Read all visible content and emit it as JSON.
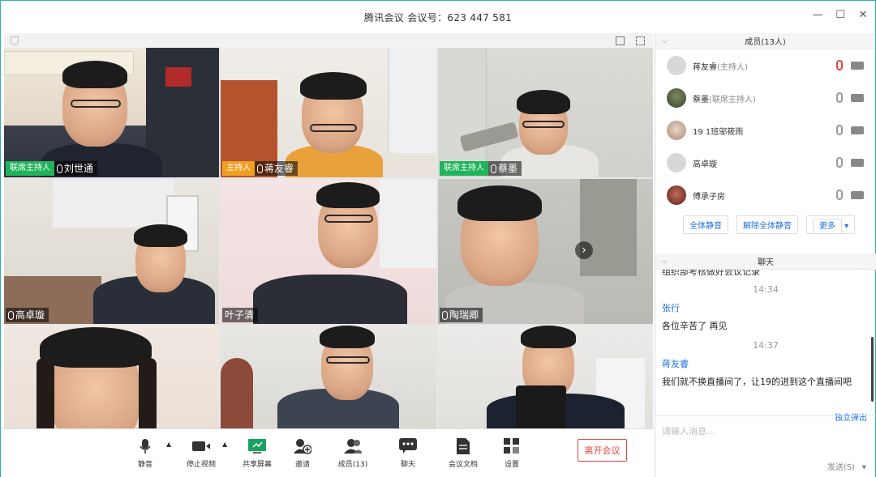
{
  "window": {
    "title": "腾讯会议 会议号：623 447 581",
    "controls": [
      "minimize-icon",
      "maximize-icon",
      "close-icon"
    ]
  },
  "video": {
    "tiles": [
      {
        "role": "联席主持人",
        "role_type": "co-host",
        "name": "刘世通",
        "show_mic": true
      },
      {
        "role": "主持人",
        "role_type": "host",
        "name": "蒋友睿",
        "show_mic": true
      },
      {
        "role": "联席主持人",
        "role_type": "co-host",
        "name": "蔡墨",
        "show_mic": true
      },
      {
        "role": "",
        "name": "高卓璇",
        "show_mic": true
      },
      {
        "role": "",
        "name": "叶子清",
        "show_mic": false
      },
      {
        "role": "",
        "name": "陶瑞卿",
        "show_mic": true
      },
      {
        "role": "",
        "name": "",
        "show_mic": false
      },
      {
        "role": "",
        "name": "",
        "show_mic": false
      },
      {
        "role": "",
        "name": "",
        "show_mic": false
      }
    ],
    "next_page_icon": "›"
  },
  "toolbar": {
    "mute": "静音",
    "stop_video": "停止视频",
    "share_screen": "共享屏幕",
    "invite": "邀请",
    "members": "成员(13)",
    "chat": "聊天",
    "docs": "会议文档",
    "settings": "设置",
    "leave": "离开会议"
  },
  "members_panel": {
    "header": "成员(13人)",
    "members": [
      {
        "name": "蒋友睿",
        "role": "(主持人)",
        "mic_muted": true
      },
      {
        "name": "蔡墨",
        "role": "(联席主持人)",
        "mic_muted": false
      },
      {
        "name": "19 1班邬筱雨",
        "role": "",
        "mic_muted": false
      },
      {
        "name": "高卓璇",
        "role": "",
        "mic_muted": false
      },
      {
        "name": "傅承子房",
        "role": "",
        "mic_muted": false
      }
    ],
    "mute_all": "全体静音",
    "unmute_all": "解除全体静音",
    "more": "更多"
  },
  "chat_panel": {
    "header": "聊天",
    "cut_message": "组织部考核做好会议记录",
    "messages": [
      {
        "time": "14:34",
        "sender": "张行",
        "text": "各位辛苦了 再见"
      },
      {
        "time": "14:37",
        "sender": "蒋友睿",
        "text": "我们就不换直播间了，让19的进到这个直播间吧"
      }
    ],
    "popout": "独立弹出",
    "input_placeholder": "请输入消息...",
    "send": "发送(S)"
  }
}
